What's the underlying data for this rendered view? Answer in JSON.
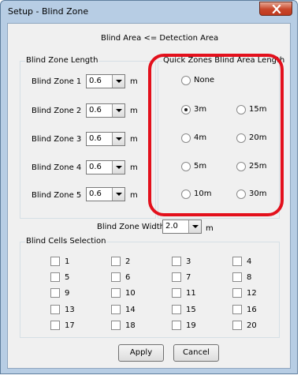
{
  "window": {
    "title": "Setup - Blind Zone"
  },
  "colors": {
    "highlight": "#e3101c",
    "window_frame": "#b7cde4",
    "close_button": "#c8462a"
  },
  "header": {
    "text": "Blind Area <= Detection Area"
  },
  "blind_zone_length": {
    "legend": "Blind Zone Length",
    "unit": "m",
    "zones": [
      {
        "label": "Blind Zone 1",
        "value": "0.6"
      },
      {
        "label": "Blind Zone 2",
        "value": "0.6"
      },
      {
        "label": "Blind Zone 3",
        "value": "0.6"
      },
      {
        "label": "Blind Zone 4",
        "value": "0.6"
      },
      {
        "label": "Blind Zone 5",
        "value": "0.6"
      }
    ]
  },
  "quick_zones": {
    "legend": "Quick Zones Blind Area Length",
    "selected": "3m",
    "options": {
      "none": "None",
      "m3": "3m",
      "m4": "4m",
      "m5": "5m",
      "m10": "10m",
      "m15": "15m",
      "m20": "20m",
      "m25": "25m",
      "m30": "30m"
    }
  },
  "blind_zone_width": {
    "label": "Blind Zone Width:",
    "value": "2.0",
    "unit": "m"
  },
  "blind_cells": {
    "legend": "Blind Cells Selection",
    "cells": [
      "1",
      "2",
      "3",
      "4",
      "5",
      "6",
      "7",
      "8",
      "9",
      "10",
      "11",
      "12",
      "13",
      "14",
      "15",
      "16",
      "17",
      "18",
      "19",
      "20"
    ]
  },
  "buttons": {
    "apply": "Apply",
    "cancel": "Cancel"
  },
  "icons": {
    "close": "close-icon",
    "dropdown": "chevron-down-icon"
  }
}
